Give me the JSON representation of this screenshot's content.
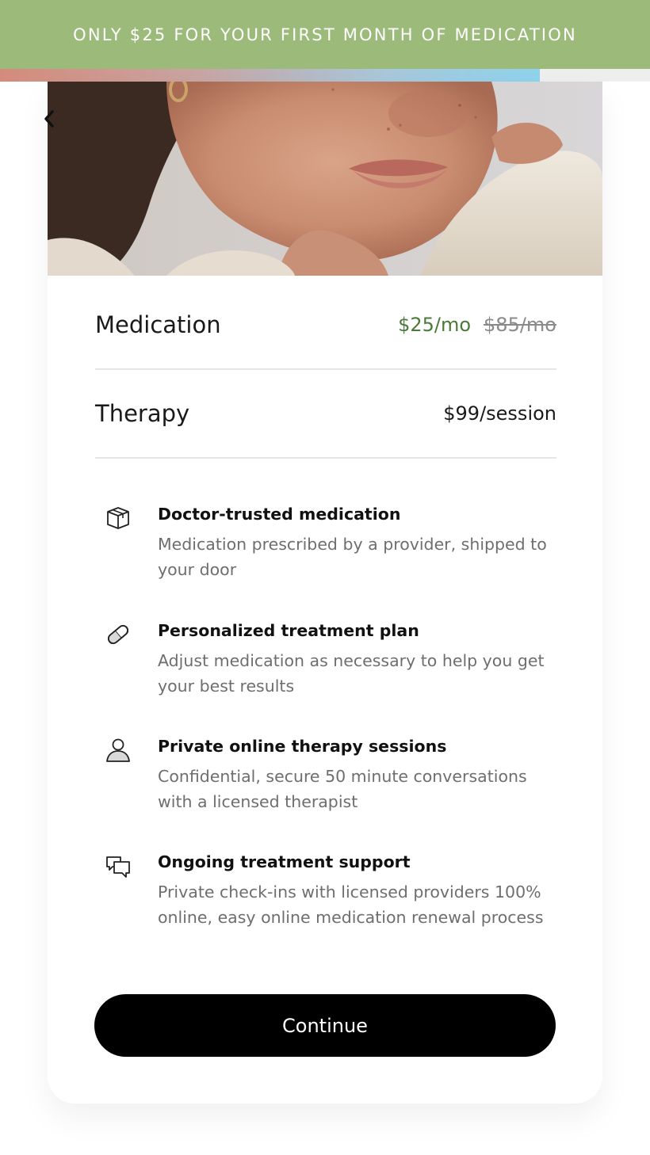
{
  "banner": {
    "text": "ONLY $25 FOR YOUR FIRST MONTH OF MEDICATION"
  },
  "progress": {
    "fraction": 0.83,
    "colors": [
      "#d48b7c",
      "#8ed3ec"
    ]
  },
  "hero": {
    "image": "woman-portrait-photo"
  },
  "back": {
    "icon": "chevron-left-icon"
  },
  "plans": [
    {
      "label": "Medication",
      "price": "$25/mo",
      "original_price": "$85/mo"
    },
    {
      "label": "Therapy",
      "price": "$99/session"
    }
  ],
  "features": [
    {
      "icon": "box-icon",
      "title": "Doctor-trusted medication",
      "description": "Medication prescribed by a provider, shipped to your door"
    },
    {
      "icon": "pill-icon",
      "title": "Personalized treatment plan",
      "description": "Adjust medication as necessary to help you get your best results"
    },
    {
      "icon": "person-icon",
      "title": "Private online therapy sessions",
      "description": "Confidential, secure 50 minute conversations with a licensed therapist"
    },
    {
      "icon": "chat-bubbles-icon",
      "title": "Ongoing treatment support",
      "description": "Private check-ins with licensed providers 100% online, easy online medication renewal process"
    }
  ],
  "continue_label": "Continue",
  "colors": {
    "banner": "#9cba7a",
    "sale_price": "#4a7a3a",
    "button": "#000000"
  }
}
